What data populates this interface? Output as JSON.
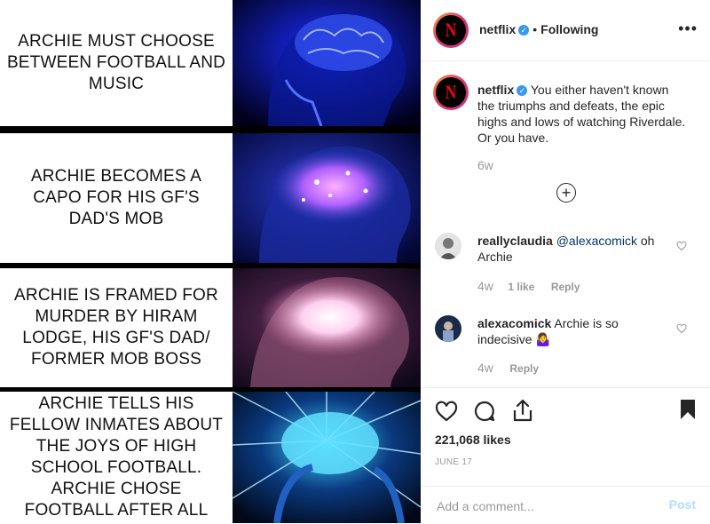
{
  "meme": {
    "panels": [
      {
        "text": "ARCHIE MUST CHOOSE BETWEEN FOOTBALL AND MUSIC",
        "glow_color": "#3a5bff"
      },
      {
        "text": "ARCHIE BECOMES A CAPO FOR HIS GF'S DAD'S MOB",
        "glow_color": "#b060ff"
      },
      {
        "text": "ARCHIE IS FRAMED FOR MURDER BY HIRAM LODGE, HIS GF'S DAD/ FORMER MOB BOSS",
        "glow_color": "#ffd0f0"
      },
      {
        "text": "ARCHIE TELLS HIS FELLOW INMATES ABOUT THE JOYS OF HIGH SCHOOL FOOTBALL. ARCHIE CHOSE FOOTBALL AFTER ALL",
        "glow_color": "#60e0ff"
      }
    ]
  },
  "header": {
    "username": "netflix",
    "separator": "•",
    "follow_status": "Following",
    "more_icon": "more-dots-icon"
  },
  "caption": {
    "username": "netflix",
    "text": "You either haven't known the triumphs and defeats, the epic highs and lows of watching Riverdale. Or you have.",
    "age": "6w"
  },
  "load_more_icon": "plus-circle-icon",
  "comments": [
    {
      "username": "reallyclaudia",
      "mention": "@alexacomick",
      "text": "oh Archie",
      "age": "4w",
      "likes": "1 like",
      "reply": "Reply"
    },
    {
      "username": "alexacomick",
      "mention": "",
      "text": "Archie is so indecisive",
      "emoji": "🤷‍♀️",
      "age": "4w",
      "likes": "",
      "reply": "Reply"
    }
  ],
  "actions": {
    "likes": "221,068 likes",
    "date": "JUNE 17"
  },
  "add_comment": {
    "placeholder": "Add a comment...",
    "post_label": "Post"
  },
  "colors": {
    "verified": "#3897f0",
    "netflix_red": "#e50914",
    "mention": "#003569",
    "post_disabled": "#b2dffc"
  }
}
